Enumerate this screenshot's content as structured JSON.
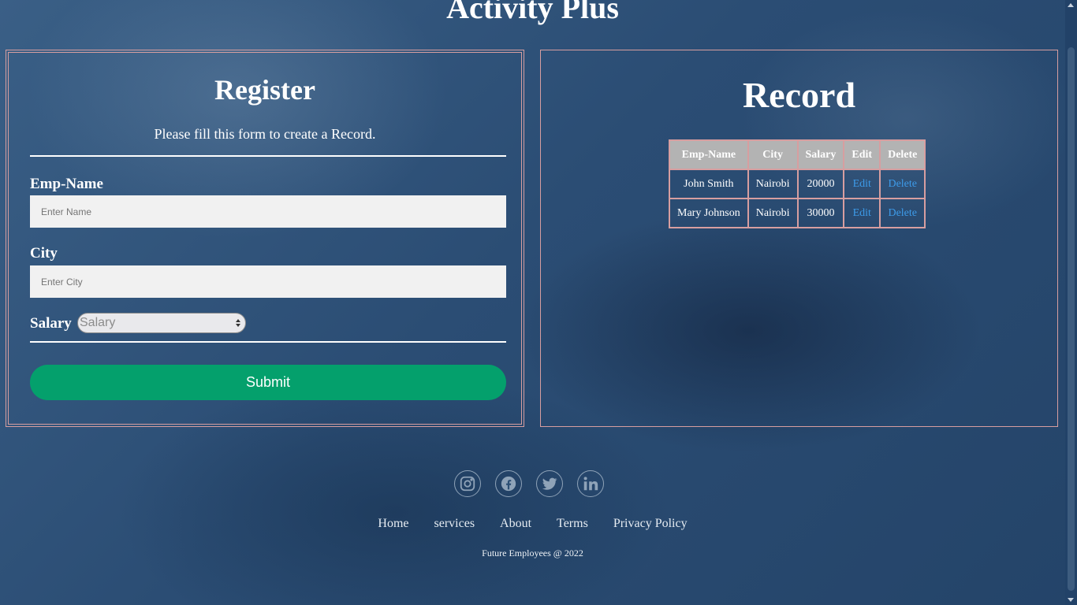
{
  "site": {
    "title": "Activity Plus"
  },
  "register": {
    "title": "Register",
    "subtitle": "Please fill this form to create a Record.",
    "name_label": "Emp-Name",
    "name_placeholder": "Enter Name",
    "city_label": "City",
    "city_placeholder": "Enter City",
    "salary_label": "Salary",
    "salary_placeholder": "Salary",
    "submit_label": "Submit"
  },
  "record": {
    "title": "Record",
    "columns": [
      "Emp-Name",
      "City",
      "Salary",
      "Edit",
      "Delete"
    ],
    "rows": [
      {
        "name": "John Smith",
        "city": "Nairobi",
        "salary": "20000",
        "edit": "Edit",
        "delete": "Delete"
      },
      {
        "name": "Mary Johnson",
        "city": "Nairobi",
        "salary": "30000",
        "edit": "Edit",
        "delete": "Delete"
      }
    ]
  },
  "footer": {
    "socials": [
      "instagram-icon",
      "facebook-icon",
      "twitter-icon",
      "linkedin-icon"
    ],
    "nav": [
      "Home",
      "services",
      "About",
      "Terms",
      "Privacy Policy"
    ],
    "copyright": "Future Employees @ 2022"
  },
  "colors": {
    "accent": "#04a06c",
    "border": "#d79ea0",
    "link": "#3d9be9",
    "header_bg": "#b3b3b3"
  }
}
